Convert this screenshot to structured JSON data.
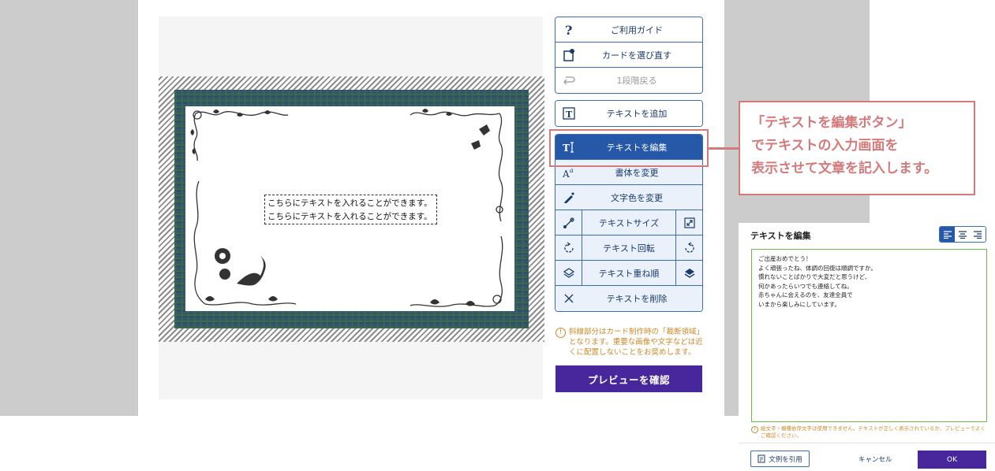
{
  "editor": {
    "card_text_lines": [
      "こちらにテキストを入れることができます。",
      "こちらにテキストを入れることができます。"
    ]
  },
  "toolbar": {
    "group1": [
      {
        "label": "ご利用ガイド",
        "icon": "question-icon",
        "enabled": true
      },
      {
        "label": "カードを選び直す",
        "icon": "card-reselect-icon",
        "enabled": true
      },
      {
        "label": "1段階戻る",
        "icon": "undo-icon",
        "enabled": false
      }
    ],
    "add_text": {
      "label": "テキストを追加",
      "icon": "text-add-icon"
    },
    "group2": [
      {
        "label": "テキストを編集",
        "icon": "text-edit-icon",
        "active": true
      },
      {
        "label": "書体を変更",
        "icon": "font-icon"
      },
      {
        "label": "文字色を変更",
        "icon": "pen-icon"
      },
      {
        "label": "テキストサイズ",
        "icon": "resize-icon",
        "icon2": "expand-icon"
      },
      {
        "label": "テキスト回転",
        "icon": "rotate-left-icon",
        "icon2": "rotate-right-icon"
      },
      {
        "label": "テキスト重ね順",
        "icon": "layers-icon",
        "icon2": "layers-filled-icon"
      },
      {
        "label": "テキストを削除",
        "icon": "close-icon"
      }
    ]
  },
  "callout": {
    "lines": [
      "「テキストを編集ボタン」",
      "でテキストの入力画面を",
      "表示させて文章を記入します。"
    ]
  },
  "notice": {
    "text": "斜線部分はカード制作時の「裁断領域」となります。重要な画像や文字などは近くに配置しないことをお奨めします。"
  },
  "preview_button": {
    "label": "プレビューを確認"
  },
  "dialog": {
    "title": "テキストを編集",
    "alignment": {
      "options": [
        "left",
        "center",
        "right"
      ],
      "selected": "left"
    },
    "text_lines": [
      "ご出産おめでとう！",
      "よく頑張ったね、体調の回復は順調ですか。",
      "慣れないことばかりで大変だと思うけど、",
      "何かあったらいつでも連絡してね。",
      "赤ちゃんに会えるのを、友達全員で",
      "いまから楽しみにしています。"
    ],
    "note": "絵文字・機種依存文字は使用できません。テキストが正しく表示されているか、プレビューでよくご確認ください。",
    "quote_button": "文例を引用",
    "cancel_button": "キャンセル",
    "ok_button": "OK"
  },
  "colors": {
    "accent": "#2658a8",
    "primary_button": "#47279b",
    "callout": "#d37a7a",
    "warning": "#c98a2a",
    "textarea_border": "#6abb4a"
  }
}
